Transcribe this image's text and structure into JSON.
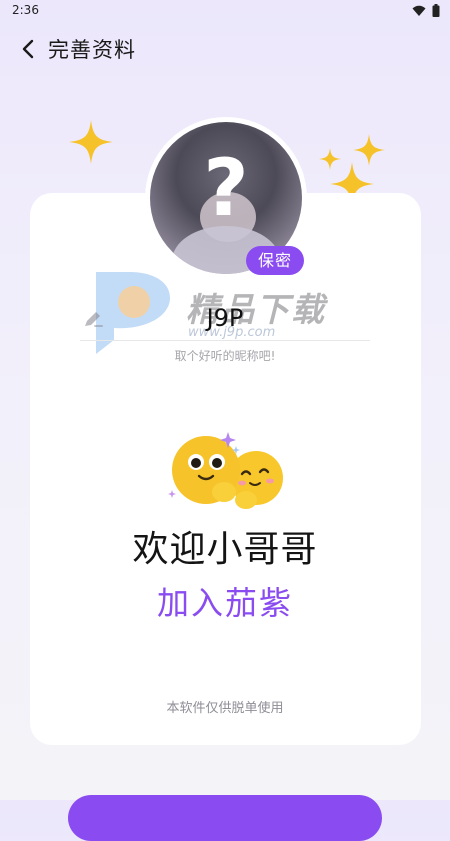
{
  "status_bar": {
    "time": "2:36",
    "icons": [
      "wifi-icon",
      "battery-icon"
    ]
  },
  "nav": {
    "title": "完善资料",
    "back_icon": "chevron-left-icon"
  },
  "avatar": {
    "placeholder_glyph": "?",
    "badge": "保密"
  },
  "watermark": {
    "text": "精品下载",
    "domain": "www.j9p.com"
  },
  "nickname": {
    "value": "J9P",
    "hint": "取个好听的昵称吧!"
  },
  "welcome": {
    "title": "欢迎小哥哥",
    "subtitle": "加入茄紫"
  },
  "footer": {
    "disclaimer": "本软件仅供脱单使用"
  },
  "colors": {
    "accent": "#8a4cf0",
    "card": "#ffffff",
    "sparkle": "#f6c22a"
  }
}
